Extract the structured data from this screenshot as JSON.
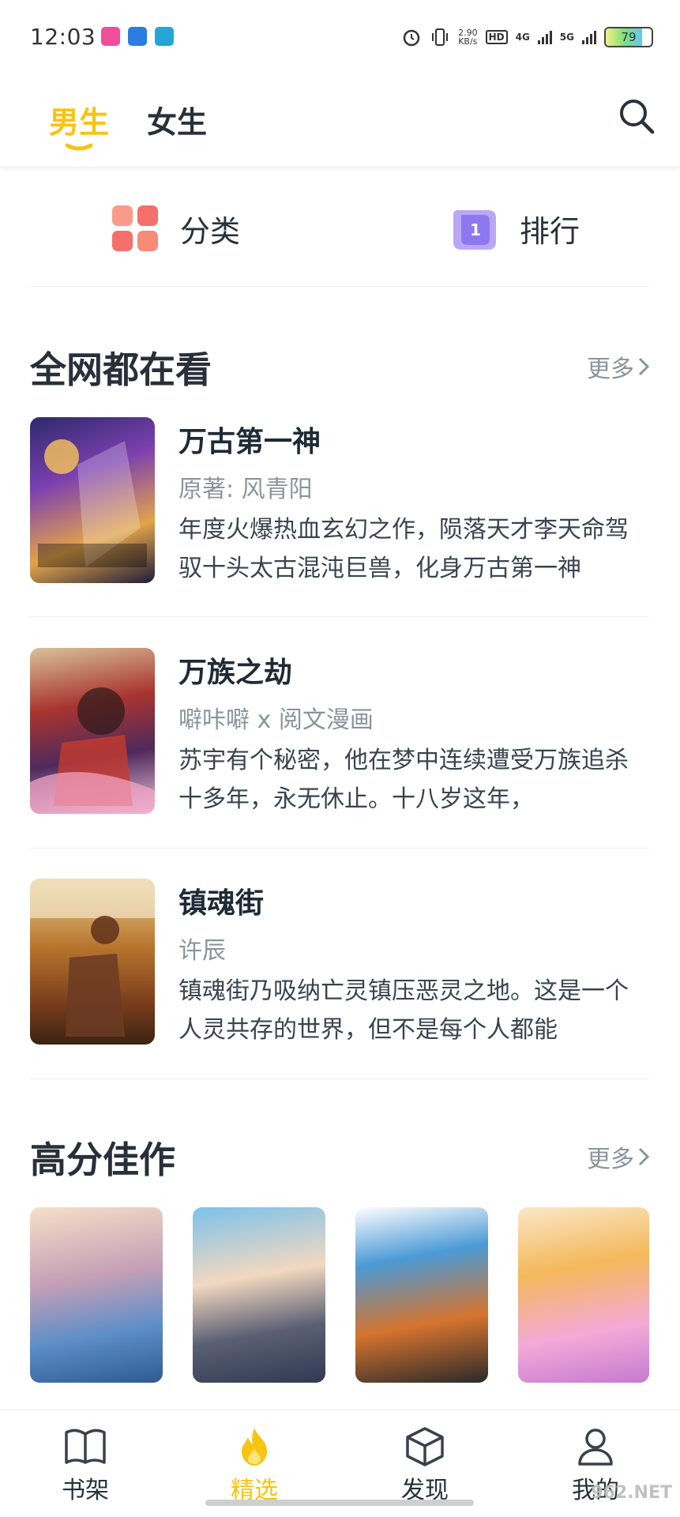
{
  "status_bar": {
    "time": "12:03",
    "net_speed_value": "2.90",
    "net_speed_unit": "KB/s",
    "hd_tag": "HD",
    "net_4g": "4G",
    "net_5g": "5G",
    "battery_level": "79"
  },
  "header": {
    "tabs": [
      {
        "label": "男生",
        "active": true
      },
      {
        "label": "女生",
        "active": false
      }
    ]
  },
  "quick": {
    "category_label": "分类",
    "ranking_label": "排行",
    "ranking_badge": "1"
  },
  "section_hot": {
    "title": "全网都在看",
    "more": "更多",
    "items": [
      {
        "title": "万古第一神",
        "author": "原著: 风青阳",
        "desc": "年度火爆热血玄幻之作，陨落天才李天命驾驭十头太古混沌巨兽，化身万古第一神"
      },
      {
        "title": "万族之劫",
        "author": "噼咔噼 x 阅文漫画",
        "desc": "苏宇有个秘密，他在梦中连续遭受万族追杀十多年，永无休止。十八岁这年，"
      },
      {
        "title": "镇魂街",
        "author": "许辰",
        "desc": "镇魂街乃吸纳亡灵镇压恶灵之地。这是一个人灵共存的世界，但不是每个人都能"
      }
    ]
  },
  "section_top": {
    "title": "高分佳作",
    "more": "更多"
  },
  "bottom_nav": [
    {
      "label": "书架",
      "icon": "book-icon",
      "active": false
    },
    {
      "label": "精选",
      "icon": "flame-icon",
      "active": true
    },
    {
      "label": "发现",
      "icon": "cube-icon",
      "active": false
    },
    {
      "label": "我的",
      "icon": "user-icon",
      "active": false
    }
  ],
  "watermark": "962.NET",
  "colors": {
    "accent": "#f7c40f",
    "text": "#1f2a37",
    "muted": "#8d939c"
  }
}
